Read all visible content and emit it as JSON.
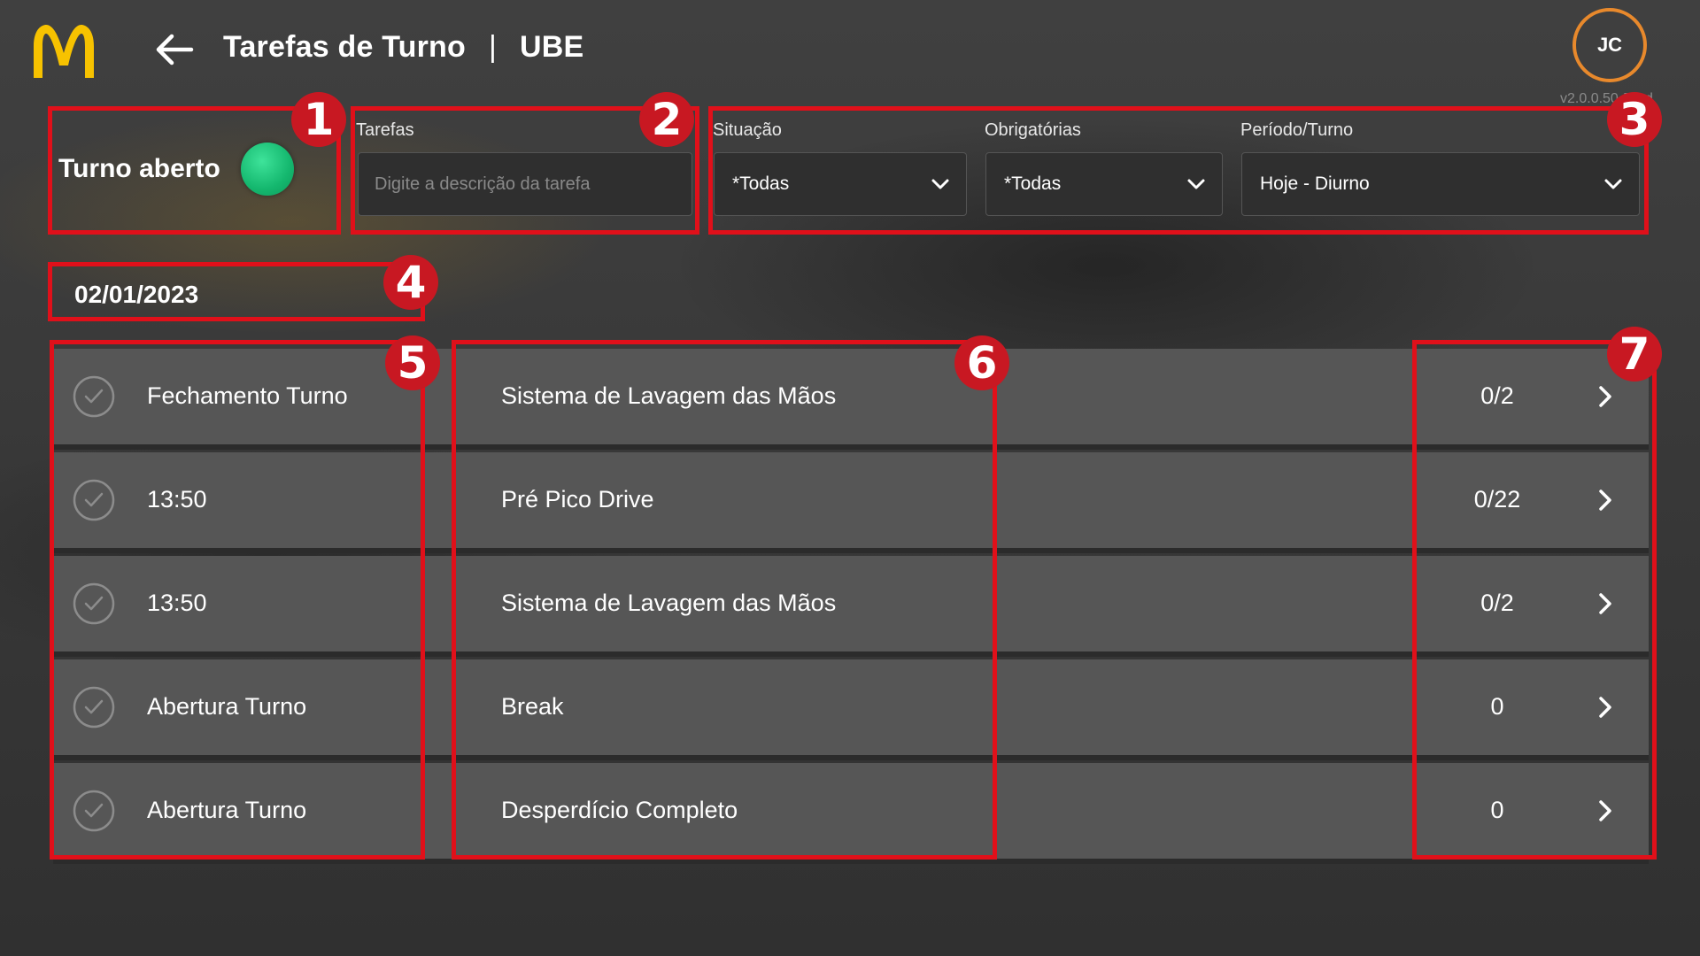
{
  "header": {
    "title": "Tarefas de Turno",
    "separator": "|",
    "store": "UBE",
    "avatar_initials": "JC",
    "version": "v2.0.0.50-Prod",
    "brand_color": "#f7c200",
    "avatar_ring_color": "#e8892c"
  },
  "turno": {
    "label": "Turno aberto",
    "status_color": "#14b76e"
  },
  "filters": {
    "tarefas_label": "Tarefas",
    "tarefas_placeholder": "Digite a descrição da tarefa",
    "situacao_label": "Situação",
    "situacao_value": "*Todas",
    "obrigatorias_label": "Obrigatórias",
    "obrigatorias_value": "*Todas",
    "periodo_label": "Período/Turno",
    "periodo_value": "Hoje - Diurno"
  },
  "date": "02/01/2023",
  "tasks": [
    {
      "time": "Fechamento Turno",
      "description": "Sistema de Lavagem das Mãos",
      "count": "0/2"
    },
    {
      "time": "13:50",
      "description": "Pré Pico Drive",
      "count": "0/22"
    },
    {
      "time": "13:50",
      "description": "Sistema de Lavagem das Mãos",
      "count": "0/2"
    },
    {
      "time": "Abertura Turno",
      "description": "Break",
      "count": "0"
    },
    {
      "time": "Abertura Turno",
      "description": "Desperdício Completo",
      "count": "0"
    }
  ],
  "annotations": {
    "color": "#e0101a",
    "labels": [
      "1",
      "2",
      "3",
      "4",
      "5",
      "6",
      "7"
    ]
  }
}
